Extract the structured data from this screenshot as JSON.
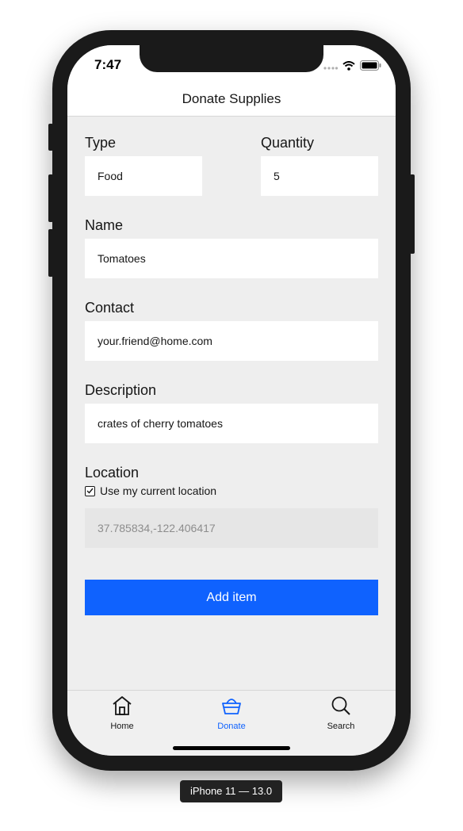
{
  "status_bar": {
    "time": "7:47"
  },
  "nav": {
    "title": "Donate Supplies"
  },
  "form": {
    "type_label": "Type",
    "type_value": "Food",
    "quantity_label": "Quantity",
    "quantity_value": "5",
    "name_label": "Name",
    "name_value": "Tomatoes",
    "contact_label": "Contact",
    "contact_value": "your.friend@home.com",
    "description_label": "Description",
    "description_value": "crates of cherry tomatoes",
    "location_label": "Location",
    "use_location_label": "Use my current location",
    "use_location_checked": true,
    "location_value": "37.785834,-122.406417",
    "submit_label": "Add item"
  },
  "tabs": [
    {
      "label": "Home",
      "icon": "home-icon",
      "active": false
    },
    {
      "label": "Donate",
      "icon": "basket-icon",
      "active": true
    },
    {
      "label": "Search",
      "icon": "search-icon",
      "active": false
    }
  ],
  "device": {
    "label": "iPhone 11 — 13.0"
  },
  "colors": {
    "accent": "#0f62fe",
    "background": "#eeeeee"
  }
}
